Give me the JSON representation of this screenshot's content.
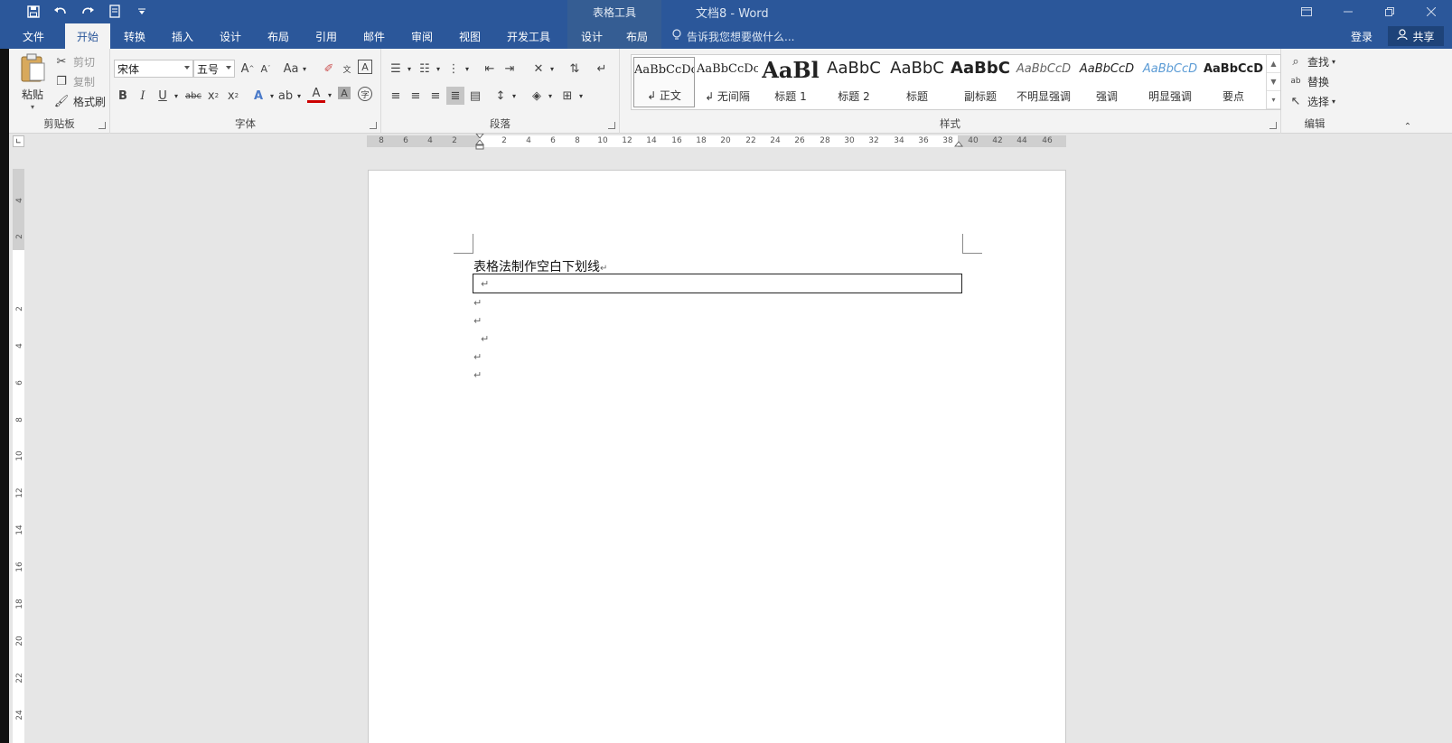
{
  "titlebar": {
    "context_label": "表格工具",
    "doc_title": "文档8 - Word"
  },
  "tabs": {
    "file": "文件",
    "home": "开始",
    "convert": "转换",
    "insert": "插入",
    "design": "设计",
    "layout": "布局",
    "references": "引用",
    "mailings": "邮件",
    "review": "审阅",
    "view": "视图",
    "developer": "开发工具",
    "table_design": "设计",
    "table_layout": "布局",
    "tell_me": "告诉我您想要做什么...",
    "login": "登录",
    "share": "共享"
  },
  "clipboard": {
    "paste": "粘贴",
    "cut": "剪切",
    "copy": "复制",
    "format_painter": "格式刷",
    "label": "剪贴板"
  },
  "font": {
    "name": "宋体",
    "size": "五号",
    "change_case": "Aa",
    "label": "字体"
  },
  "paragraph": {
    "label": "段落"
  },
  "styles": {
    "label": "样式",
    "items": [
      {
        "preview": "AaBbCcDc",
        "name": "↲ 正文"
      },
      {
        "preview": "AaBbCcDc",
        "name": "↲ 无间隔"
      },
      {
        "preview": "AaBl",
        "name": "标题 1"
      },
      {
        "preview": "AaBbC",
        "name": "标题 2"
      },
      {
        "preview": "AaBbC",
        "name": "标题"
      },
      {
        "preview": "AaBbC",
        "name": "副标题"
      },
      {
        "preview": "AaBbCcD",
        "name": "不明显强调"
      },
      {
        "preview": "AaBbCcD",
        "name": "强调"
      },
      {
        "preview": "AaBbCcD",
        "name": "明显强调"
      },
      {
        "preview": "AaBbCcD",
        "name": "要点"
      }
    ]
  },
  "editing": {
    "find": "查找",
    "replace": "替换",
    "select": "选择",
    "label": "编辑"
  },
  "ruler": {
    "h_left": [
      "8",
      "6",
      "4",
      "2"
    ],
    "h_right": [
      "2",
      "4",
      "6",
      "8",
      "10",
      "12",
      "14",
      "16",
      "18",
      "20",
      "22",
      "24",
      "26",
      "28",
      "30",
      "32",
      "34",
      "36",
      "38",
      "40",
      "42",
      "44",
      "46"
    ],
    "v_top": [
      "4",
      "2"
    ],
    "v_bottom": [
      "2",
      "4",
      "6",
      "8",
      "10",
      "12",
      "14",
      "16",
      "18",
      "20",
      "22",
      "24"
    ]
  },
  "document": {
    "heading": "表格法制作空白下划线",
    "para_mark": "↵"
  },
  "colors": {
    "title_blue": "#2b579a",
    "ribbon_bg": "#f3f3f3",
    "workspace": "#e6e6e6"
  }
}
